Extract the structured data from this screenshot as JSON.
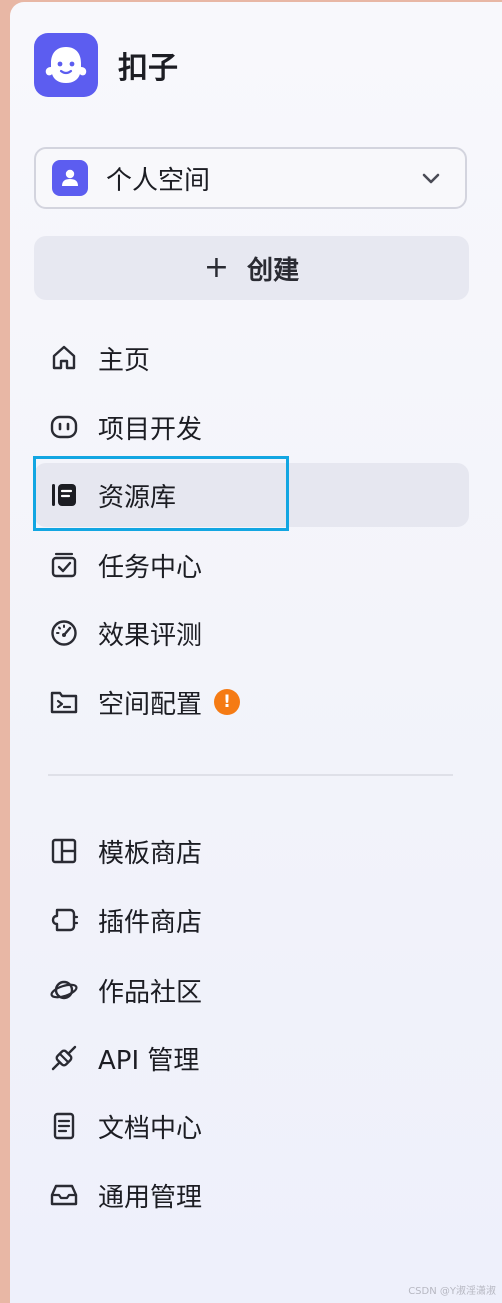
{
  "app": {
    "title": "扣子",
    "logo_icon": "ghost-mascot-icon",
    "brand_color": "#5c5df0"
  },
  "workspace": {
    "label": "个人空间",
    "icon": "user-icon",
    "chevron": "chevron-down-icon"
  },
  "create": {
    "plus": "+",
    "label": "创建"
  },
  "nav_primary": [
    {
      "label": "主页",
      "icon": "home-icon"
    },
    {
      "label": "项目开发",
      "icon": "bot-face-icon"
    },
    {
      "label": "资源库",
      "icon": "library-icon",
      "active": true
    },
    {
      "label": "任务中心",
      "icon": "task-check-icon"
    },
    {
      "label": "效果评测",
      "icon": "gauge-icon"
    },
    {
      "label": "空间配置",
      "icon": "terminal-folder-icon",
      "badge": "!"
    }
  ],
  "nav_secondary": [
    {
      "label": "模板商店",
      "icon": "template-layout-icon"
    },
    {
      "label": "插件商店",
      "icon": "plugin-icon"
    },
    {
      "label": "作品社区",
      "icon": "planet-icon"
    },
    {
      "label": "API 管理",
      "icon": "api-plug-icon"
    },
    {
      "label": "文档中心",
      "icon": "document-icon"
    },
    {
      "label": "通用管理",
      "icon": "inbox-icon"
    }
  ],
  "watermark": "CSDN @Y淑淫潇淑",
  "colors": {
    "badge": "#f57b14",
    "highlight": "#12a6e2",
    "active_bg": "#e6e7f0"
  }
}
